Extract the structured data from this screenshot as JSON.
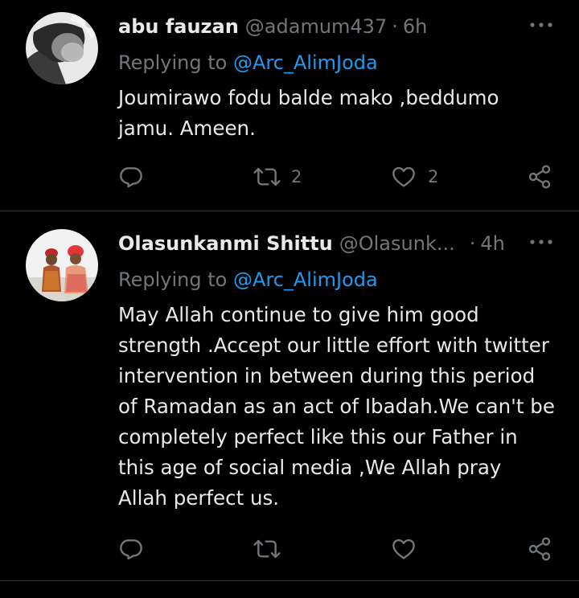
{
  "tweets": [
    {
      "display_name": "abu fauzan",
      "handle": "@adamum437",
      "separator": "·",
      "time": "6h",
      "replying_prefix": "Replying to ",
      "replying_to": "@Arc_AlimJoda",
      "text": "Joumirawo fodu balde mako ,beddumo jamu. Ameen.",
      "reply_count": "",
      "retweet_count": "2",
      "like_count": "2"
    },
    {
      "display_name": "Olasunkanmi Shittu",
      "handle": "@Olasunk...",
      "separator": "·",
      "time": "4h",
      "replying_prefix": "Replying to ",
      "replying_to": "@Arc_AlimJoda",
      "text": "May Allah continue to give him good strength .Accept our little effort with twitter intervention in between during this period of Ramadan as an act of Ibadah.We can't be completely perfect like this our Father in this age of social media ,We Allah pray Allah perfect us.",
      "reply_count": "",
      "retweet_count": "",
      "like_count": ""
    }
  ],
  "colors": {
    "background": "#000000",
    "primary_text": "#e7e9ea",
    "secondary_text": "#71767b",
    "link": "#1d9bf0",
    "divider": "#2f3336"
  },
  "icons": {
    "reply": "reply-icon",
    "retweet": "retweet-icon",
    "like": "heart-icon",
    "share": "share-icon",
    "more": "more-icon"
  }
}
